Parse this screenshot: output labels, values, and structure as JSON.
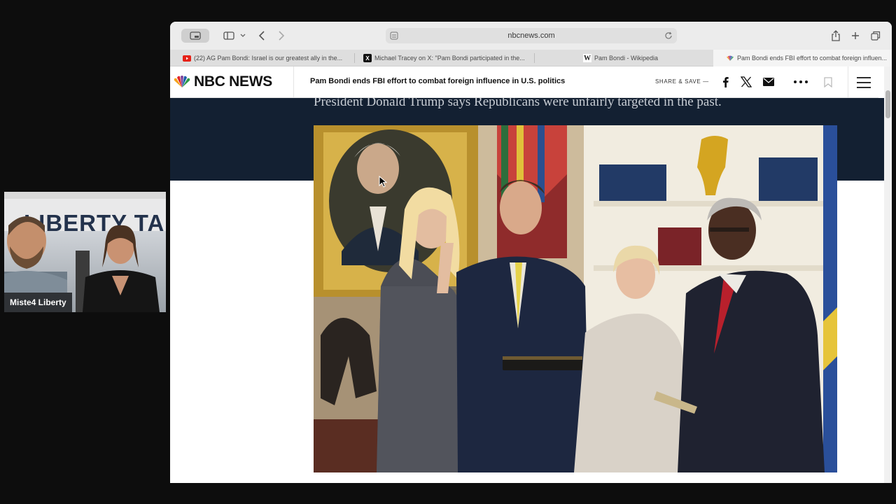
{
  "webcam": {
    "banner_text": "LIBERTY TAL",
    "name_tag": "Miste4 Liberty"
  },
  "browser": {
    "address": "nbcnews.com",
    "tabs": [
      {
        "label": "(22) AG Pam Bondi: Israel is our greatest ally in the...",
        "favicon": "youtube-icon"
      },
      {
        "label": "Michael Tracey on X: \"Pam Bondi participated in the...",
        "favicon": "x-icon"
      },
      {
        "label": "Pam Bondi - Wikipedia",
        "favicon": "wikipedia-icon"
      },
      {
        "label": "Pam Bondi ends FBI effort to combat foreign influen...",
        "favicon": "nbc-peacock-icon"
      }
    ]
  },
  "nbc": {
    "logo_text": "NBC NEWS",
    "headline": "Pam Bondi ends FBI effort to combat foreign influence in U.S. politics",
    "share_label": "SHARE & SAVE —",
    "dek": "President Donald Trump says Republicans were unfairly targeted in the past."
  },
  "colors": {
    "hero_bg": "#132032",
    "nbc_peacock": [
      "#f5a21b",
      "#e1272d",
      "#7b3f99",
      "#1e5fac",
      "#2e9a47",
      "#f37021"
    ]
  }
}
